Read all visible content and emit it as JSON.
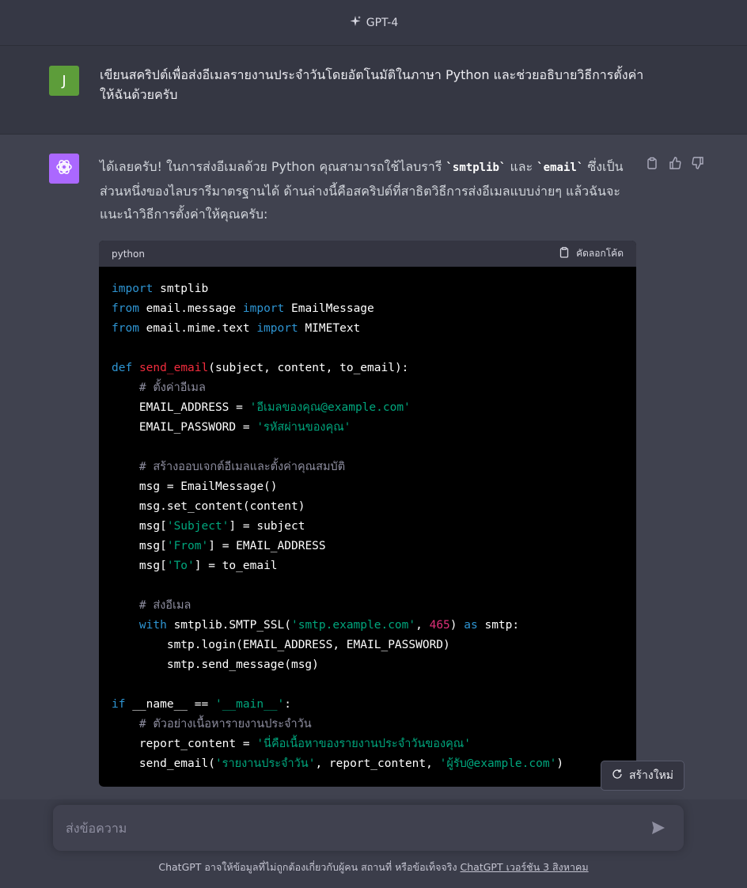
{
  "header": {
    "model": "GPT-4"
  },
  "user_message": {
    "avatar_initial": "J",
    "text": "เขียนสคริปต์เพื่อส่งอีเมลรายงานประจำวันโดยอัตโนมัติในภาษา Python และช่วยอธิบายวิธีการตั้งค่าให้ฉันด้วยครับ"
  },
  "assistant_message": {
    "intro_part1": "ได้เลยครับ! ในการส่งอีเมลด้วย Python คุณสามารถใช้ไลบรารี ",
    "intro_code1": "`smtplib`",
    "intro_part2": " และ ",
    "intro_code2": "`email`",
    "intro_part3": " ซึ่งเป็นส่วนหนึ่งของไลบรารีมาตรฐานได้ ด้านล่างนี้คือสคริปต์ที่สาธิตวิธีการส่งอีเมลแบบง่ายๆ แล้วฉันจะแนะนำวิธีการตั้งค่าให้คุณครับ:",
    "code_block": {
      "language": "python",
      "copy_label": "คัดลอกโค้ด",
      "lines": [
        [
          [
            "kw",
            "import"
          ],
          [
            "tx",
            " smtplib"
          ]
        ],
        [
          [
            "kw",
            "from"
          ],
          [
            "tx",
            " email.message "
          ],
          [
            "kw",
            "import"
          ],
          [
            "tx",
            " EmailMessage"
          ]
        ],
        [
          [
            "kw",
            "from"
          ],
          [
            "tx",
            " email.mime.text "
          ],
          [
            "kw",
            "import"
          ],
          [
            "tx",
            " MIMEText"
          ]
        ],
        [],
        [
          [
            "kw",
            "def"
          ],
          [
            "tx",
            " "
          ],
          [
            "fn",
            "send_email"
          ],
          [
            "tx",
            "(subject, content, to_email):"
          ]
        ],
        [
          [
            "tx",
            "    "
          ],
          [
            "cm",
            "# ตั้งค่าอีเมล"
          ]
        ],
        [
          [
            "tx",
            "    EMAIL_ADDRESS = "
          ],
          [
            "st",
            "'อีเมลของคุณ@example.com'"
          ]
        ],
        [
          [
            "tx",
            "    EMAIL_PASSWORD = "
          ],
          [
            "st",
            "'รหัสผ่านของคุณ'"
          ]
        ],
        [],
        [
          [
            "tx",
            "    "
          ],
          [
            "cm",
            "# สร้างออบเจกต์อีเมลและตั้งค่าคุณสมบัติ"
          ]
        ],
        [
          [
            "tx",
            "    msg = EmailMessage()"
          ]
        ],
        [
          [
            "tx",
            "    msg.set_content(content)"
          ]
        ],
        [
          [
            "tx",
            "    msg["
          ],
          [
            "st",
            "'Subject'"
          ],
          [
            "tx",
            "] = subject"
          ]
        ],
        [
          [
            "tx",
            "    msg["
          ],
          [
            "st",
            "'From'"
          ],
          [
            "tx",
            "] = EMAIL_ADDRESS"
          ]
        ],
        [
          [
            "tx",
            "    msg["
          ],
          [
            "st",
            "'To'"
          ],
          [
            "tx",
            "] = to_email"
          ]
        ],
        [],
        [
          [
            "tx",
            "    "
          ],
          [
            "cm",
            "# ส่งอีเมล"
          ]
        ],
        [
          [
            "tx",
            "    "
          ],
          [
            "kw",
            "with"
          ],
          [
            "tx",
            " smtplib.SMTP_SSL("
          ],
          [
            "st",
            "'smtp.example.com'"
          ],
          [
            "tx",
            ", "
          ],
          [
            "nm",
            "465"
          ],
          [
            "tx",
            ") "
          ],
          [
            "kw",
            "as"
          ],
          [
            "tx",
            " smtp:"
          ]
        ],
        [
          [
            "tx",
            "        smtp.login(EMAIL_ADDRESS, EMAIL_PASSWORD)"
          ]
        ],
        [
          [
            "tx",
            "        smtp.send_message(msg)"
          ]
        ],
        [],
        [
          [
            "kw",
            "if"
          ],
          [
            "tx",
            " __name__ == "
          ],
          [
            "st",
            "'__main__'"
          ],
          [
            "tx",
            ":"
          ]
        ],
        [
          [
            "tx",
            "    "
          ],
          [
            "cm",
            "# ตัวอย่างเนื้อหารายงานประจำวัน"
          ]
        ],
        [
          [
            "tx",
            "    report_content = "
          ],
          [
            "st",
            "'นี่คือเนื้อหาของรายงานประจำวันของคุณ'"
          ]
        ],
        [
          [
            "tx",
            "    send_email("
          ],
          [
            "st",
            "'รายงานประจำวัน'"
          ],
          [
            "tx",
            ", report_content, "
          ],
          [
            "st",
            "'ผู้รับ@example.com'"
          ],
          [
            "tx",
            ")"
          ]
        ]
      ]
    }
  },
  "regenerate_label": "สร้างใหม่",
  "composer": {
    "placeholder": "ส่งข้อความ"
  },
  "footer": {
    "text": "ChatGPT อาจให้ข้อมูลที่ไม่ถูกต้องเกี่ยวกับผู้คน สถานที่ หรือข้อเท็จจริง ",
    "link": "ChatGPT เวอร์ชัน 3 สิงหาคม"
  },
  "colors": {
    "user_avatar": "#5d9d3a",
    "gpt_avatar": "#ab68ff",
    "keyword": "#2e95d3",
    "function": "#f22c3d",
    "string": "#00a67d",
    "number": "#df3079",
    "comment": "#8e8ea0"
  },
  "icons": [
    "sparkle-icon",
    "openai-logo-icon",
    "clipboard-icon",
    "thumbs-up-icon",
    "thumbs-down-icon",
    "copy-icon",
    "refresh-icon",
    "send-icon"
  ]
}
